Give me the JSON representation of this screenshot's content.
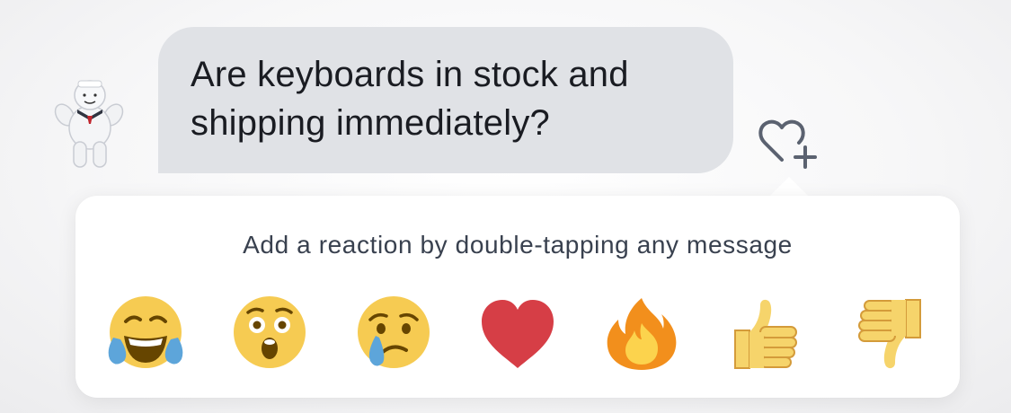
{
  "message": {
    "line1": "Are keyboards in stock and",
    "line2": "shipping immediately?",
    "bubble_color": "#e0e2e6"
  },
  "reaction_panel": {
    "hint": "Add a reaction by double-tapping any message",
    "reactions": [
      {
        "name": "face-with-tears-of-joy"
      },
      {
        "name": "astonished-face"
      },
      {
        "name": "crying-face"
      },
      {
        "name": "red-heart"
      },
      {
        "name": "fire"
      },
      {
        "name": "thumbs-up"
      },
      {
        "name": "thumbs-down"
      }
    ]
  },
  "icons": {
    "add_reaction": "heart-plus-icon",
    "avatar": "marshmallow-man-avatar"
  },
  "colors": {
    "emoji_yellow": "#f6cb52",
    "heart_red": "#d63e46",
    "tear_blue": "#5da5da",
    "icon_gray": "#5b6270"
  }
}
